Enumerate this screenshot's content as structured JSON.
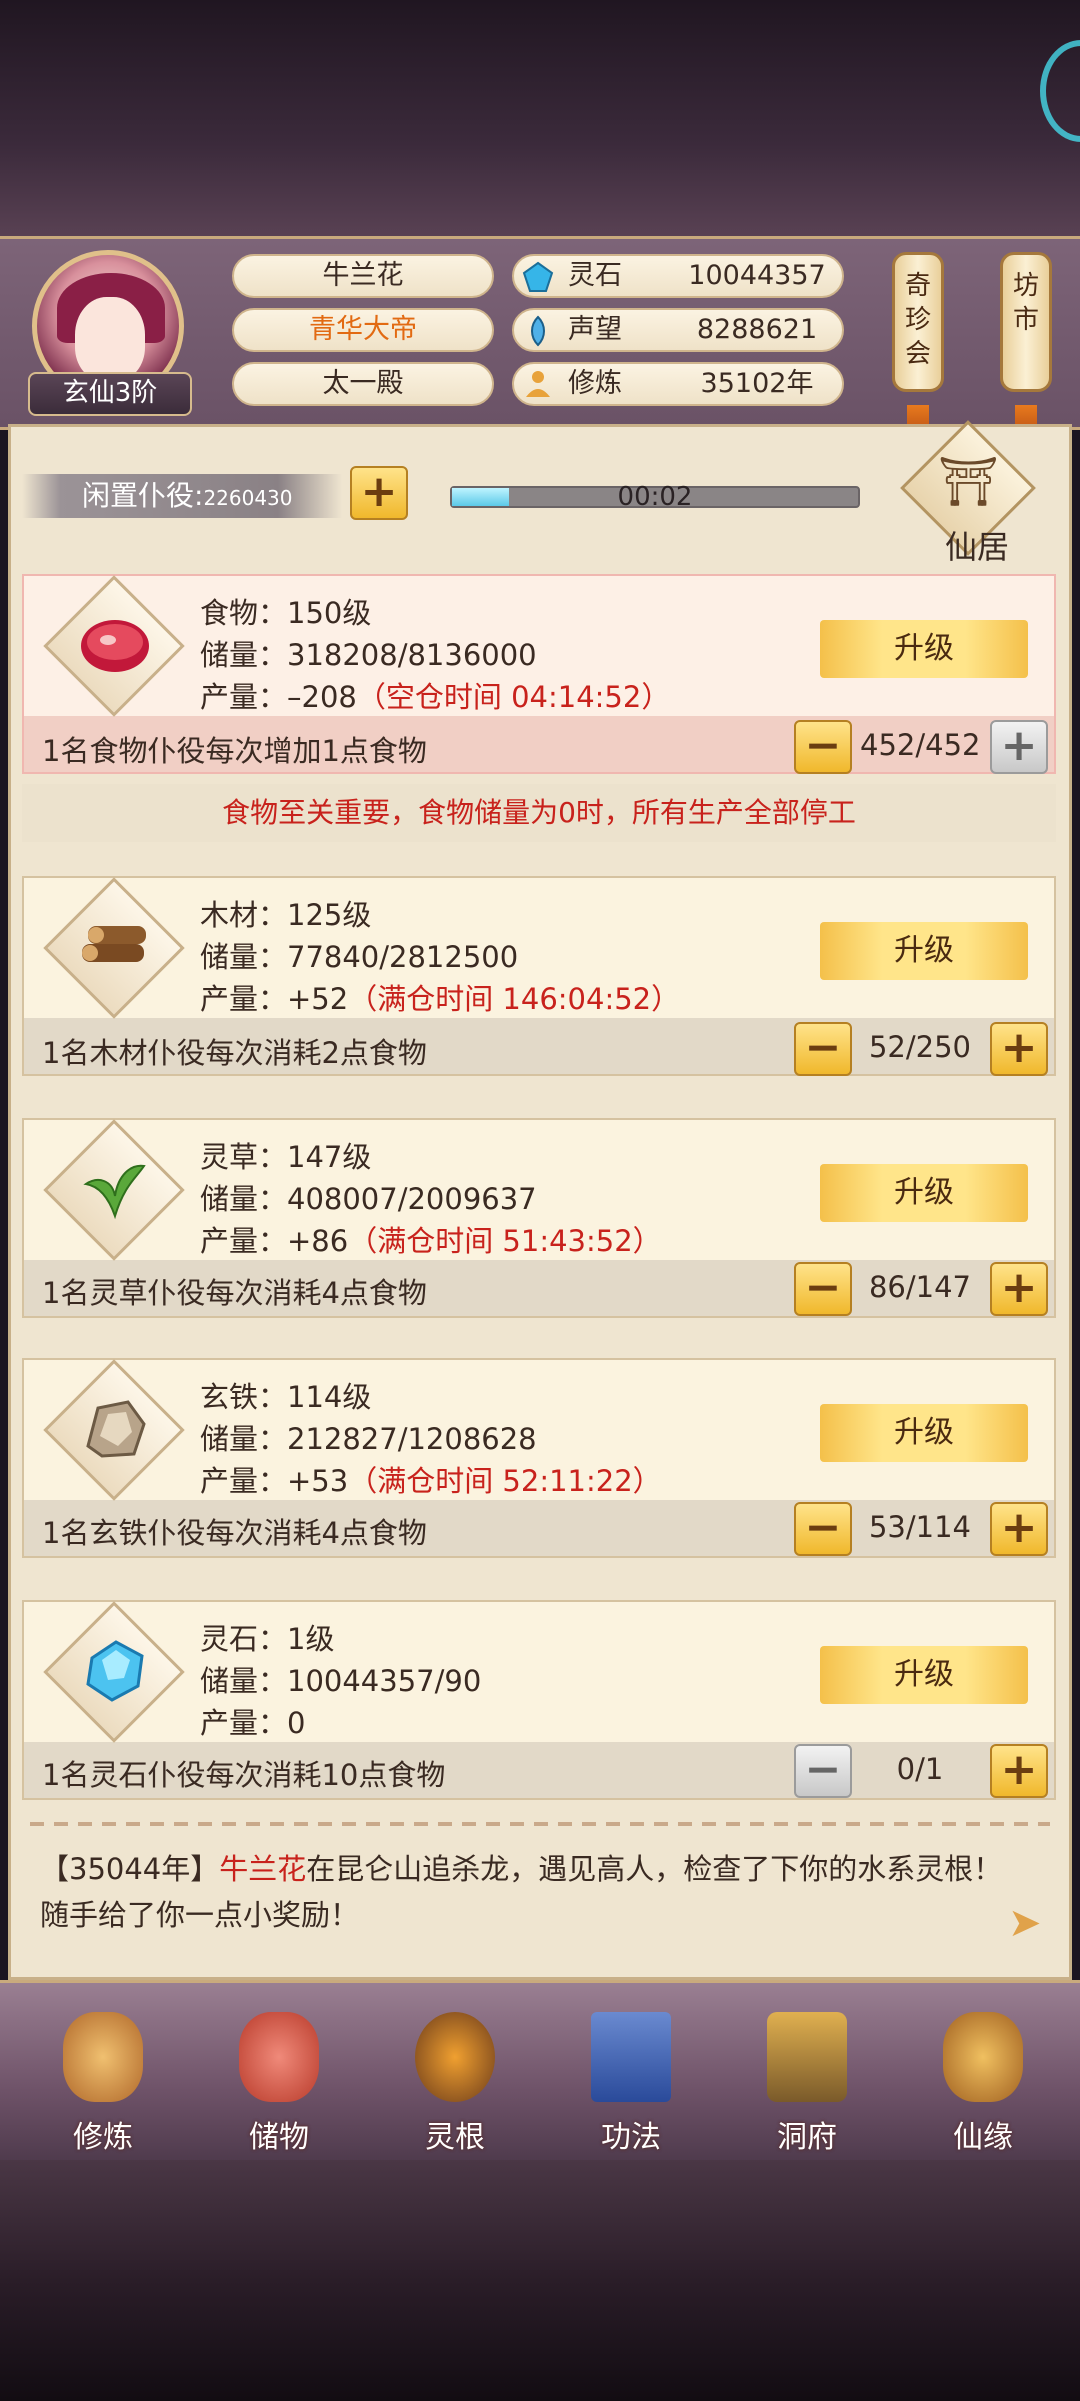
{
  "header": {
    "rank": "玄仙3阶",
    "name": "牛兰花",
    "title": "青华大帝",
    "hall": "太一殿",
    "stats": [
      {
        "label": "灵石",
        "value": "10044357",
        "icon": "spirit-stone-icon"
      },
      {
        "label": "声望",
        "value": "8288621",
        "icon": "prestige-icon"
      },
      {
        "label": "修炼",
        "value": "35102年",
        "icon": "meditation-icon"
      }
    ],
    "lanterns": [
      "奇珍会",
      "坊市"
    ]
  },
  "idle": {
    "label": "闲置仆役:",
    "count": "2260430",
    "timer": "00:02",
    "progress": 0.14
  },
  "xianju": {
    "label": "仙居"
  },
  "resources": [
    {
      "key": "food",
      "name": "食物：150级",
      "storage": "储量：318208/8136000",
      "output": "产量：–208",
      "output_note": "（空仓时间 04:14:52）",
      "hint": "1名食物仆役每次增加1点食物",
      "count": "452/452",
      "upgrade": "升级"
    },
    {
      "key": "wood",
      "name": "木材：125级",
      "storage": "储量：77840/2812500",
      "output": "产量：+52",
      "output_note": "（满仓时间 146:04:52）",
      "hint": "1名木材仆役每次消耗2点食物",
      "count": "52/250",
      "upgrade": "升级"
    },
    {
      "key": "herb",
      "name": "灵草：147级",
      "storage": "储量：408007/2009637",
      "output": "产量：+86",
      "output_note": "（满仓时间 51:43:52）",
      "hint": "1名灵草仆役每次消耗4点食物",
      "count": "86/147",
      "upgrade": "升级"
    },
    {
      "key": "iron",
      "name": "玄铁：114级",
      "storage": "储量：212827/1208628",
      "output": "产量：+53",
      "output_note": "（满仓时间 52:11:22）",
      "hint": "1名玄铁仆役每次消耗4点食物",
      "count": "53/114",
      "upgrade": "升级"
    },
    {
      "key": "stone",
      "name": "灵石：1级",
      "storage": "储量：10044357/90",
      "output": "产量：0",
      "output_note": "",
      "hint": "1名灵石仆役每次消耗10点食物",
      "count": "0/1",
      "upgrade": "升级"
    }
  ],
  "food_warning": "食物至关重要，食物储量为0时，所有生产全部停工",
  "news": {
    "year": "【35044年】",
    "name": "牛兰花",
    "text": "在昆仑山追杀龙，遇见高人，检查了下你的水系灵根！随手给了你一点小奖励！"
  },
  "nav": [
    "修炼",
    "储物",
    "灵根",
    "功法",
    "洞府",
    "仙缘"
  ],
  "colors": {
    "accent": "#f0b82c",
    "warn": "#c8221c",
    "title_orange": "#e26a12"
  }
}
